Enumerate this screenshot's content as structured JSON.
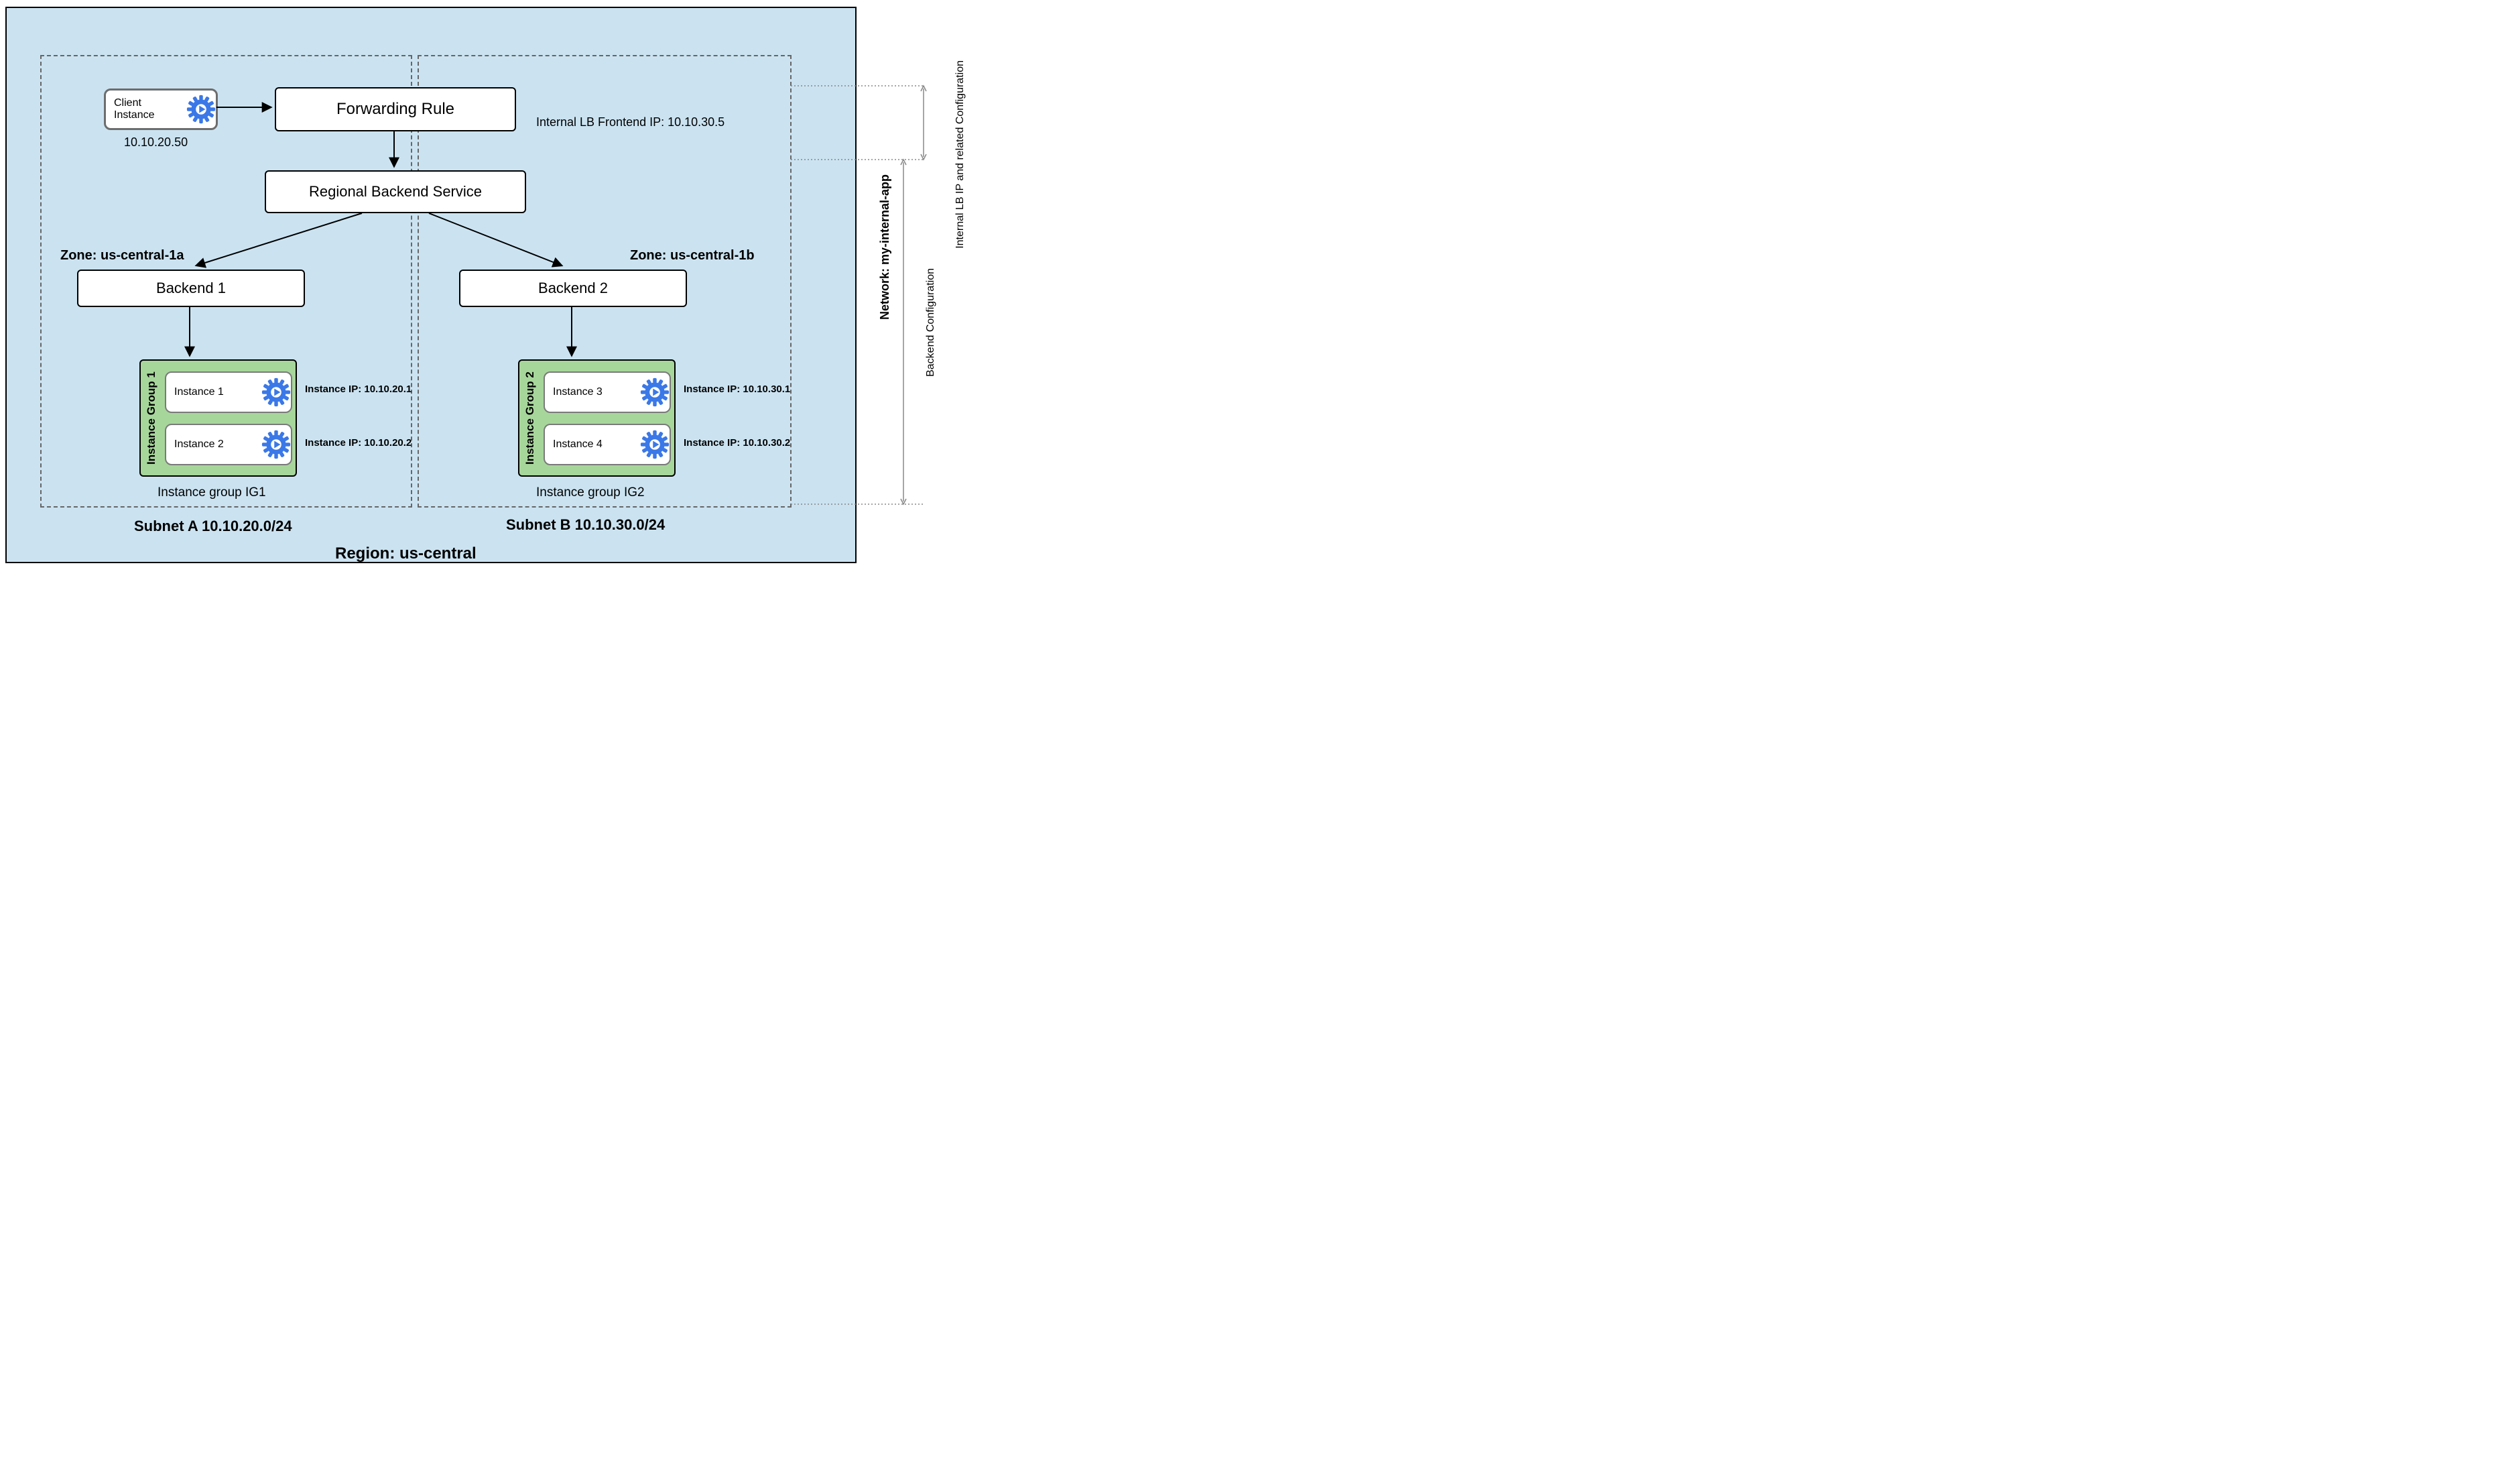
{
  "network_name": "Network: my-internal-app",
  "region_label": "Region: us-central",
  "client": {
    "label": "Client Instance",
    "ip": "10.10.20.50"
  },
  "forwarding_rule": {
    "label": "Forwarding Rule"
  },
  "backend_service": {
    "label": "Regional Backend Service"
  },
  "frontend_ip_label": "Internal LB Frontend IP: 10.10.30.5",
  "zones": {
    "a": "Zone: us-central-1a",
    "b": "Zone: us-central-1b"
  },
  "backend1": {
    "label": "Backend 1"
  },
  "backend2": {
    "label": "Backend 2"
  },
  "ig1": {
    "title": "Instance Group 1",
    "caption": "Instance group IG1",
    "instances": [
      {
        "name": "Instance 1",
        "ip_label": "Instance IP: 10.10.20.1"
      },
      {
        "name": "Instance 2",
        "ip_label": "Instance IP: 10.10.20.2"
      }
    ]
  },
  "ig2": {
    "title": "Instance Group 2",
    "caption": "Instance group IG2",
    "instances": [
      {
        "name": "Instance 3",
        "ip_label": "Instance IP: 10.10.30.1"
      },
      {
        "name": "Instance 4",
        "ip_label": "Instance IP: 10.10.30.2"
      }
    ]
  },
  "subnets": {
    "a": "Subnet A 10.10.20.0/24",
    "b": "Subnet B 10.10.30.0/24"
  },
  "side_labels": {
    "ilb": "Internal LB IP and related Configuration",
    "backend": "Backend  Configuration"
  }
}
